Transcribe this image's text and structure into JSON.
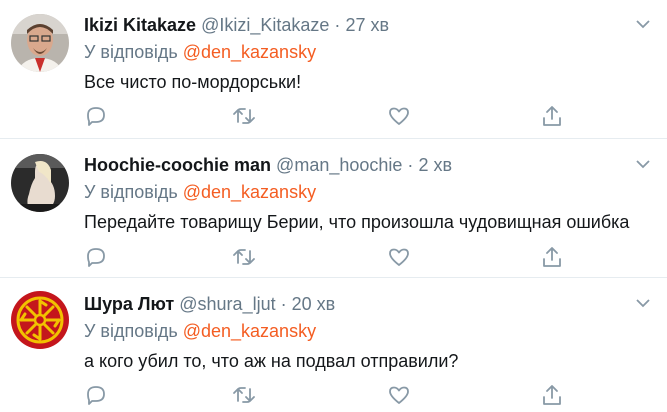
{
  "tweets": [
    {
      "name": "Ikizi Kitakaze",
      "handle": "@Ikizi_Kitakaze",
      "time": "27 хв",
      "reply_prefix": "У відповідь",
      "reply_to": "@den_kazansky",
      "text": "Все чисто по-мордорськи!"
    },
    {
      "name": "Hoochie-coochie man",
      "handle": "@man_hoochie",
      "time": "2 хв",
      "reply_prefix": "У відповідь",
      "reply_to": "@den_kazansky",
      "text": "Передайте товарищу Берии, что произошла чудовищная ошибка"
    },
    {
      "name": "Шура Лют",
      "handle": "@shura_ljut",
      "time": "20 хв",
      "reply_prefix": "У відповідь",
      "reply_to": "@den_kazansky",
      "text": "а кого убил то, что аж на подвал отправили?"
    }
  ],
  "separator": "·",
  "icons": [
    "reply-icon",
    "retweet-icon",
    "like-icon",
    "share-icon",
    "chevron-down-icon"
  ],
  "colors": {
    "mention": "#f45d22",
    "muted": "#657786",
    "text": "#14171a"
  }
}
